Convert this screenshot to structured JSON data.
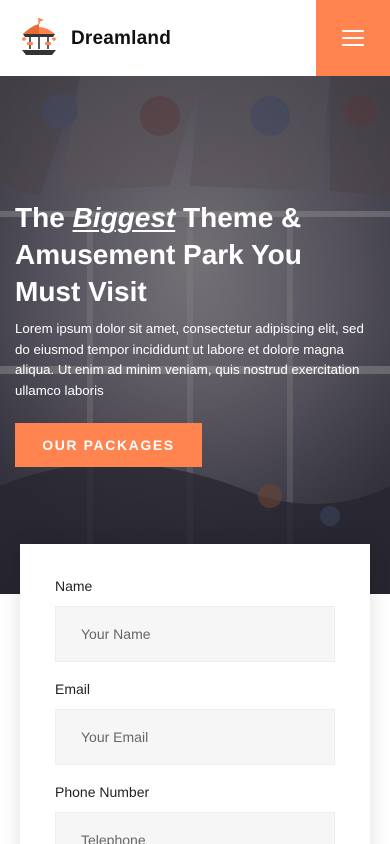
{
  "brand": {
    "name": "Dreamland",
    "accent_color": "#ff8450"
  },
  "header": {
    "logo_icon": "carousel-icon",
    "menu_icon": "hamburger-menu-icon"
  },
  "hero": {
    "title_prefix": "The ",
    "title_accent": "Biggest",
    "title_line1_rest": " Theme &",
    "title_line2": "Amusement Park You",
    "title_line3": "Must Visit",
    "description": "Lorem ipsum dolor sit amet, consectetur adipiscing elit, sed do eiusmod tempor incididunt ut labore et dolore magna aliqua. Ut enim ad minim veniam, quis nostrud exercitation ullamco laboris",
    "cta_label": "OUR PACKAGES"
  },
  "form": {
    "fields": [
      {
        "label": "Name",
        "placeholder": "Your Name"
      },
      {
        "label": "Email",
        "placeholder": "Your Email"
      },
      {
        "label": "Phone Number",
        "placeholder": "Telephone"
      }
    ]
  }
}
